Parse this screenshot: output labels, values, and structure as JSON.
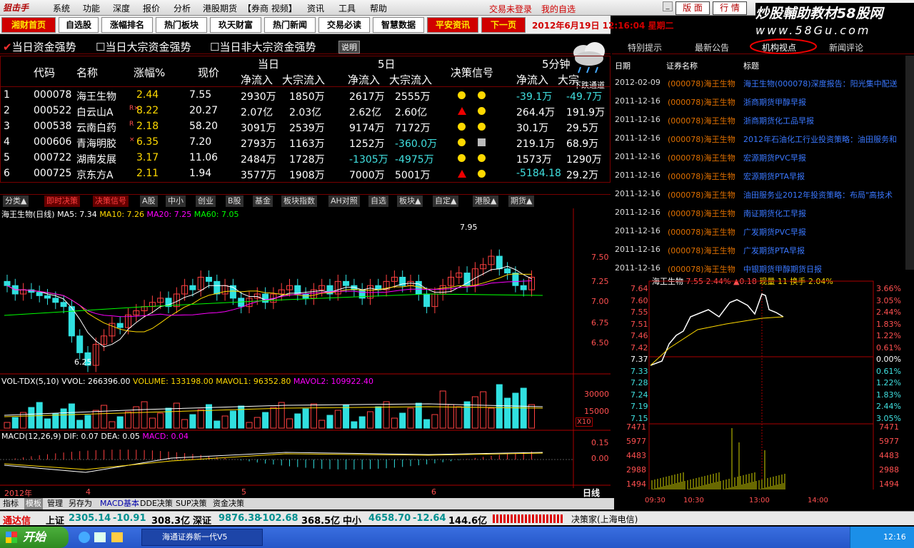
{
  "menubar": {
    "logo": "狙击手",
    "items": [
      "系统",
      "功能",
      "深度",
      "报价",
      "分析",
      "港股期货",
      "【券商 视频】",
      "资讯",
      "工具",
      "帮助"
    ],
    "login": "交易未登录",
    "fav": "我的自选",
    "btn_layout": "版 面",
    "btn_quote": "行 情"
  },
  "brand": {
    "line1": "炒股輔助教材58股网",
    "line2": "www.58Gu.com"
  },
  "toolbar": {
    "items": [
      "湘财首页",
      "自选股",
      "涨幅排名",
      "热门板块",
      "玖天财富",
      "热门新闻",
      "交易必读",
      "智慧数据",
      "平安资讯",
      "下一页"
    ],
    "date": "2012年6月19日  12:16:04 星期二"
  },
  "head": {
    "c1": "当日资金强势",
    "c2": "当日大宗资金强势",
    "c3": "当日非大宗资金强势",
    "btn": "说明"
  },
  "table": {
    "g1": "当日",
    "g2": "5日",
    "g3": "决策信号",
    "g4": "5分钟",
    "cols": [
      "代码",
      "名称",
      "涨幅%",
      "现价",
      "净流入",
      "大宗流入",
      "净流入",
      "大宗流入",
      "净流入",
      "大宗"
    ],
    "rows": [
      [
        "1",
        "000078",
        "海王生物",
        "",
        "2.44",
        "7.55",
        "2930万",
        "1850万",
        "2617万",
        "2555万",
        "-39.1万",
        "-49.7万"
      ],
      [
        "2",
        "000522",
        "白云山A",
        "R×",
        "8.22",
        "20.27",
        "2.07亿",
        "2.03亿",
        "2.62亿",
        "2.60亿",
        "264.4万",
        "191.9万"
      ],
      [
        "3",
        "000538",
        "云南白药",
        "R",
        "2.18",
        "58.20",
        "3091万",
        "2539万",
        "9174万",
        "7172万",
        "30.1万",
        "29.5万"
      ],
      [
        "4",
        "000606",
        "青海明胶",
        "×",
        "6.35",
        "7.20",
        "2793万",
        "1163万",
        "1252万",
        "-360.0万",
        "219.1万",
        "68.9万"
      ],
      [
        "5",
        "000722",
        "湖南发展",
        "",
        "3.17",
        "11.06",
        "2484万",
        "1728万",
        "-1305万",
        "-4975万",
        "1573万",
        "1290万"
      ],
      [
        "6",
        "000725",
        "京东方A",
        "",
        "2.11",
        "1.94",
        "3577万",
        "1908万",
        "7000万",
        "5001万",
        "-5184.18",
        "29.2万"
      ]
    ]
  },
  "weather": {
    "label": "下跌通道"
  },
  "tabs": [
    "分类▲",
    "即时决策",
    "决策信号",
    "A股",
    "中小",
    "创业",
    "B股",
    "基金",
    "板块指数",
    "AH对照",
    "自选",
    "板块▲",
    "自定▲",
    "港股▲",
    "期货▲"
  ],
  "chart": {
    "title": "海王生物(日线)",
    "ma5": "MA5: 7.34",
    "ma10": "MA10: 7.26",
    "ma20": "MA20: 7.25",
    "ma60": "MA60: 7.05",
    "high": "7.95",
    "low": "6.25",
    "ylabels": [
      "7.50",
      "7.25",
      "7.00",
      "6.75",
      "6.50"
    ],
    "vol": "VOL-TDX(5,10)  VVOL: 266396.00",
    "volume": "VOLUME: 133198.00",
    "mavol1": "MAVOL1: 96352.80",
    "mavol2": "MAVOL2: 109922.40",
    "vol_ticks": [
      "30000",
      "15000"
    ],
    "vol_unit": "X10",
    "macd": "MACD(12,26,9)  DIF: 0.07  DEA: 0.05",
    "macd_v": "MACD: 0.04",
    "macd_ticks": [
      "0.15",
      "0.00"
    ],
    "x_labels": [
      "2012年",
      "4",
      "5",
      "6"
    ],
    "period": "日线"
  },
  "rtabs": [
    "特别提示",
    "最新公告",
    "机构视点",
    "新闻评论"
  ],
  "news_head": [
    "日期",
    "证券名称",
    "标题"
  ],
  "news": [
    [
      "2012-02-09",
      "(000078)海王生物",
      "海王生物(000078)深度报告：阳光集中配送"
    ],
    [
      "2011-12-16",
      "(000078)海王生物",
      "浙商期货甲醇早报"
    ],
    [
      "2011-12-16",
      "(000078)海王生物",
      "浙商期货化工品早报"
    ],
    [
      "2011-12-16",
      "(000078)海王生物",
      "2012年石油化工行业投资策略：油田服务和"
    ],
    [
      "2011-12-16",
      "(000078)海王生物",
      "宏源期货PVC早报"
    ],
    [
      "2011-12-16",
      "(000078)海王生物",
      "宏源期货PTA早报"
    ],
    [
      "2011-12-16",
      "(000078)海王生物",
      "油田服务业2012年投资策略：布局\"高技术"
    ],
    [
      "2011-12-16",
      "(000078)海王生物",
      "南证期货化工早报"
    ],
    [
      "2011-12-16",
      "(000078)海王生物",
      "广发期货PVC早报"
    ],
    [
      "2011-12-16",
      "(000078)海王生物",
      "广发期货PTA早报"
    ],
    [
      "2011-12-16",
      "(000078)海王生物",
      "中银期货甲醇期货日报"
    ]
  ],
  "mini": {
    "name": "海王生物",
    "price": "7.55",
    "pct": "2.44%",
    "chg": "▲0.18",
    "vol": "现量 11",
    "turn": "换手 2.04%",
    "left": [
      "7.64",
      "7.60",
      "7.55",
      "7.51",
      "7.46",
      "7.42",
      "7.37",
      "7.33",
      "7.28",
      "7.24",
      "7.19",
      "7.15"
    ],
    "right": [
      "3.66%",
      "3.05%",
      "2.44%",
      "1.83%",
      "1.22%",
      "0.61%",
      "0.00%",
      "0.61%",
      "1.22%",
      "1.83%",
      "2.44%",
      "3.05%"
    ],
    "vleft": [
      "7471",
      "5977",
      "4483",
      "2988",
      "1494"
    ],
    "vright": [
      "7471",
      "5977",
      "4483",
      "2988",
      "1494"
    ],
    "times": [
      "09:30",
      "10:30",
      "13:00",
      "14:00"
    ]
  },
  "bottombar": [
    "指标",
    "模板",
    "管理",
    "另存为",
    "MACD基本",
    "DDE决策",
    "SUP决策",
    "资金决策"
  ],
  "status": {
    "brand": "通达信",
    "sh": "上证",
    "sh_v": "2305.14",
    "sh_c": "-10.91",
    "sh_a": "308.3亿",
    "sz": "深证",
    "sz_v": "9876.38",
    "sz_c": "-102.68",
    "sz_a": "368.5亿",
    "zx": "中小",
    "zx_v": "4658.70",
    "zx_c": "-12.64",
    "zx_a": "144.6亿",
    "server": "决策家(上海电信)"
  },
  "taskbar": {
    "start": "开始",
    "task": "海通证券新一代V5",
    "time": "12:16"
  }
}
